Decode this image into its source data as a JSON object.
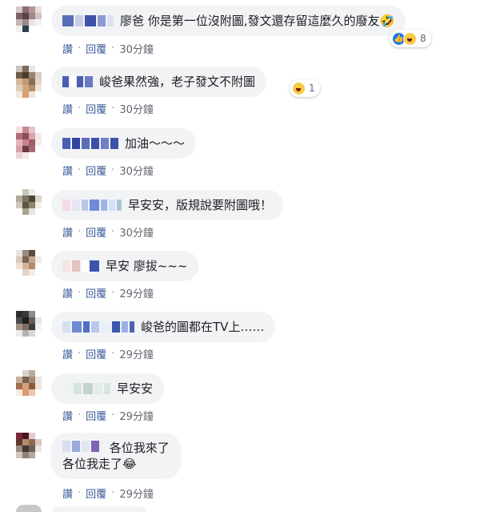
{
  "labels": {
    "like": "讚",
    "reply": "回覆",
    "separator": "·"
  },
  "comments": [
    {
      "text": "廖爸 你是第一位沒附圖,發文還存留這麼久的廢友🤣",
      "time": "30分鐘",
      "reactions": {
        "icons": [
          "like-icon",
          "haha-icon"
        ],
        "count": "8"
      }
    },
    {
      "text": "峻爸果然強，老子發文不附圖",
      "time": "30分鐘",
      "reactions": {
        "icons": [
          "haha-icon"
        ],
        "count": "1"
      }
    },
    {
      "text": "加油～～～",
      "time": "30分鐘"
    },
    {
      "text": "早安安，版規說要附圖哦！",
      "time": "30分鐘"
    },
    {
      "text": "早安 廖拔~~~",
      "time": "29分鐘"
    },
    {
      "text": "峻爸的圖都在TV上……",
      "time": "29分鐘"
    },
    {
      "text": "早安安",
      "time": "29分鐘"
    },
    {
      "line1": "各位我來了",
      "line2": "各位我走了😂",
      "time": "29分鐘"
    }
  ],
  "colors": {
    "bubble": "#f2f3f5",
    "link": "#385898",
    "meta": "#606770",
    "like": "#1877f2"
  }
}
